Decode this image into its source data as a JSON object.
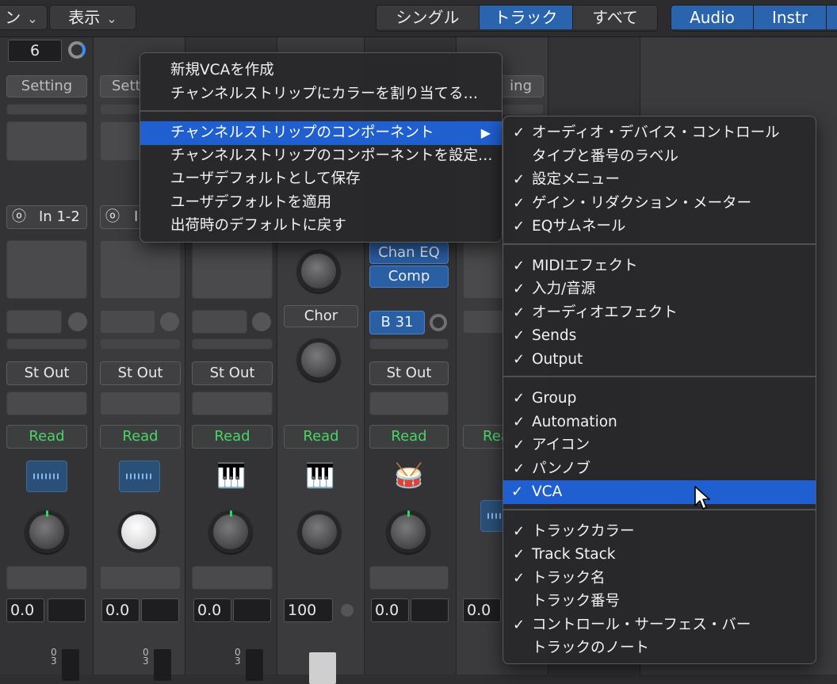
{
  "topbar": {
    "left_menu_label": "ン",
    "view_menu_label": "表示",
    "filter_segments": [
      "シングル",
      "トラック",
      "すべて"
    ],
    "filter_active": "トラック",
    "type_segments": [
      "Audio",
      "Instr"
    ]
  },
  "mixer": {
    "strip1": {
      "counter_value": "6",
      "setting_label": "Setting",
      "input_label": "In 1-2",
      "output_label": "St Out",
      "automation_label": "Read",
      "volume_value": "0.0"
    },
    "strip2": {
      "setting_label": "Sett",
      "input_label": "I",
      "output_label": "St Out",
      "automation_label": "Read",
      "volume_value": "0.0"
    },
    "strip3": {
      "output_label": "St Out",
      "automation_label": "Read",
      "volume_value": "0.0"
    },
    "strip4": {
      "send_label": "Chor",
      "automation_label": "Read",
      "volume_value": "100"
    },
    "strip5": {
      "plugins": [
        "Chan EQ",
        "Comp"
      ],
      "bus_label": "B 31",
      "output_label": "St Out",
      "automation_label": "Read",
      "volume_value": "0.0"
    },
    "strip6": {
      "setting_label": "ing",
      "automation_label": "Rea",
      "volume_value": "0.0"
    },
    "scale": [
      "0",
      "3"
    ]
  },
  "context_menu": {
    "items": [
      "新規VCAを作成",
      "チャンネルストリップにカラーを割り当てる…",
      "チャンネルストリップのコンポーネント",
      "チャンネルストリップのコンポーネントを設定…",
      "ユーザデフォルトとして保存",
      "ユーザデフォルトを適用",
      "出荷時のデフォルトに戻す"
    ],
    "submenu_arrow": "▶"
  },
  "submenu": {
    "check_glyph": "✓",
    "groups": [
      [
        {
          "label": "オーディオ・デバイス・コントロール",
          "checked": true
        },
        {
          "label": "タイプと番号のラベル",
          "checked": false
        },
        {
          "label": "設定メニュー",
          "checked": true
        },
        {
          "label": "ゲイン・リダクション・メーター",
          "checked": true
        },
        {
          "label": "EQサムネール",
          "checked": true
        }
      ],
      [
        {
          "label": "MIDIエフェクト",
          "checked": true
        },
        {
          "label": "入力/音源",
          "checked": true
        },
        {
          "label": "オーディオエフェクト",
          "checked": true
        },
        {
          "label": "Sends",
          "checked": true
        },
        {
          "label": "Output",
          "checked": true
        }
      ],
      [
        {
          "label": "Group",
          "checked": true
        },
        {
          "label": "Automation",
          "checked": true
        },
        {
          "label": "アイコン",
          "checked": true
        },
        {
          "label": "パンノブ",
          "checked": true
        },
        {
          "label": "VCA",
          "checked": true
        }
      ],
      [
        {
          "label": "トラックカラー",
          "checked": true
        },
        {
          "label": "Track Stack",
          "checked": true
        },
        {
          "label": "トラック名",
          "checked": true
        },
        {
          "label": "トラック番号",
          "checked": false
        },
        {
          "label": "コントロール・サーフェス・バー",
          "checked": true
        },
        {
          "label": "トラックのノート",
          "checked": false
        }
      ]
    ]
  }
}
